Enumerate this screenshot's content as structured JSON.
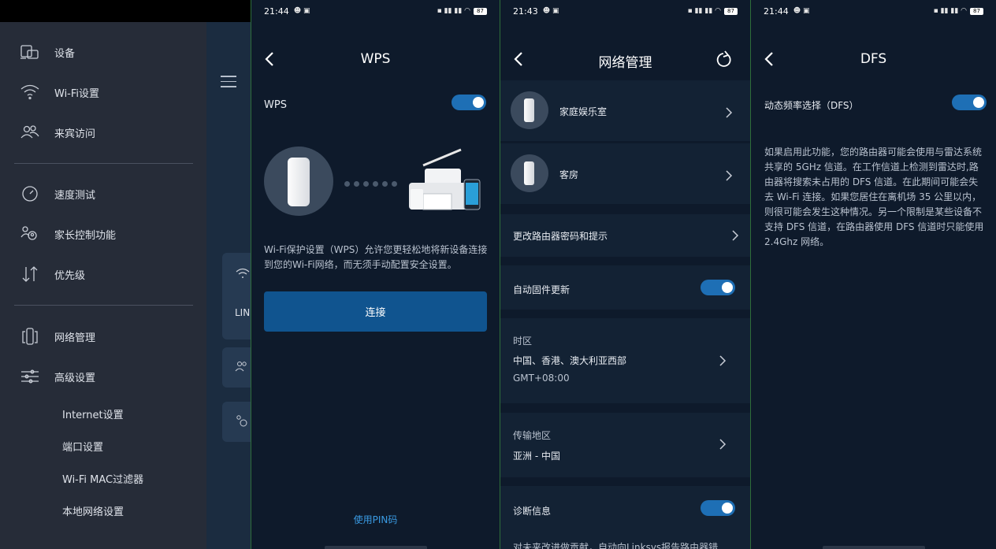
{
  "sidebar": {
    "items": [
      {
        "label": "设备",
        "icon": "devices-icon"
      },
      {
        "label": "Wi-Fi设置",
        "icon": "wifi-icon"
      },
      {
        "label": "来宾访问",
        "icon": "guest-icon"
      },
      {
        "label": "速度测试",
        "icon": "speedometer-icon"
      },
      {
        "label": "家长控制功能",
        "icon": "parental-icon"
      },
      {
        "label": "优先级",
        "icon": "priority-icon"
      },
      {
        "label": "网络管理",
        "icon": "network-icon"
      },
      {
        "label": "高级设置",
        "icon": "sliders-icon"
      }
    ],
    "subitems": [
      "Internet设置",
      "端口设置",
      "Wi-Fi MAC过滤器",
      "本地网络设置"
    ],
    "peek_text": "LIN"
  },
  "wps": {
    "status_time": "21:44",
    "battery": "87",
    "title": "WPS",
    "toggle_label": "WPS",
    "toggle_on": true,
    "description": "Wi-Fi保护设置（WPS）允许您更轻松地将新设备连接到您的Wi-Fi网络，而无须手动配置安全设置。",
    "connect_label": "连接",
    "pin_link": "使用PIN码"
  },
  "network": {
    "status_time": "21:43",
    "battery": "87",
    "title": "网络管理",
    "nodes": [
      {
        "label": "家庭娱乐室"
      },
      {
        "label": "客房"
      }
    ],
    "change_password": "更改路由器密码和提示",
    "auto_update": "自动固件更新",
    "auto_update_on": true,
    "timezone_label": "时区",
    "timezone_value": "中国、香港、澳大利亚西部",
    "timezone_offset": "GMT+08:00",
    "region_label": "传输地区",
    "region_value": "亚洲 - 中国",
    "diagnostics": "诊断信息",
    "diagnostics_on": true,
    "footer_partial": "对未来改进做贡献，自动向Linksys报告路由器错"
  },
  "dfs": {
    "status_time": "21:44",
    "battery": "87",
    "title": "DFS",
    "toggle_label": "动态频率选择（DFS）",
    "toggle_on": true,
    "description": "如果启用此功能，您的路由器可能会使用与雷达系统共享的 5GHz 信道。在工作信道上检测到雷达时,路由器将搜索未占用的 DFS 信道。在此期间可能会失去 Wi-Fi 连接。如果您居住在离机场 35 公里以内，则很可能会发生这种情况。另一个限制是某些设备不支持 DFS 信道，在路由器使用 DFS 信道时只能使用 2.4Ghz 网络。"
  },
  "colors": {
    "accent": "#1e6fb5",
    "button": "#10548f",
    "link": "#3a9be3",
    "bg": "#0e1a2b",
    "sidebar": "#262c38"
  }
}
